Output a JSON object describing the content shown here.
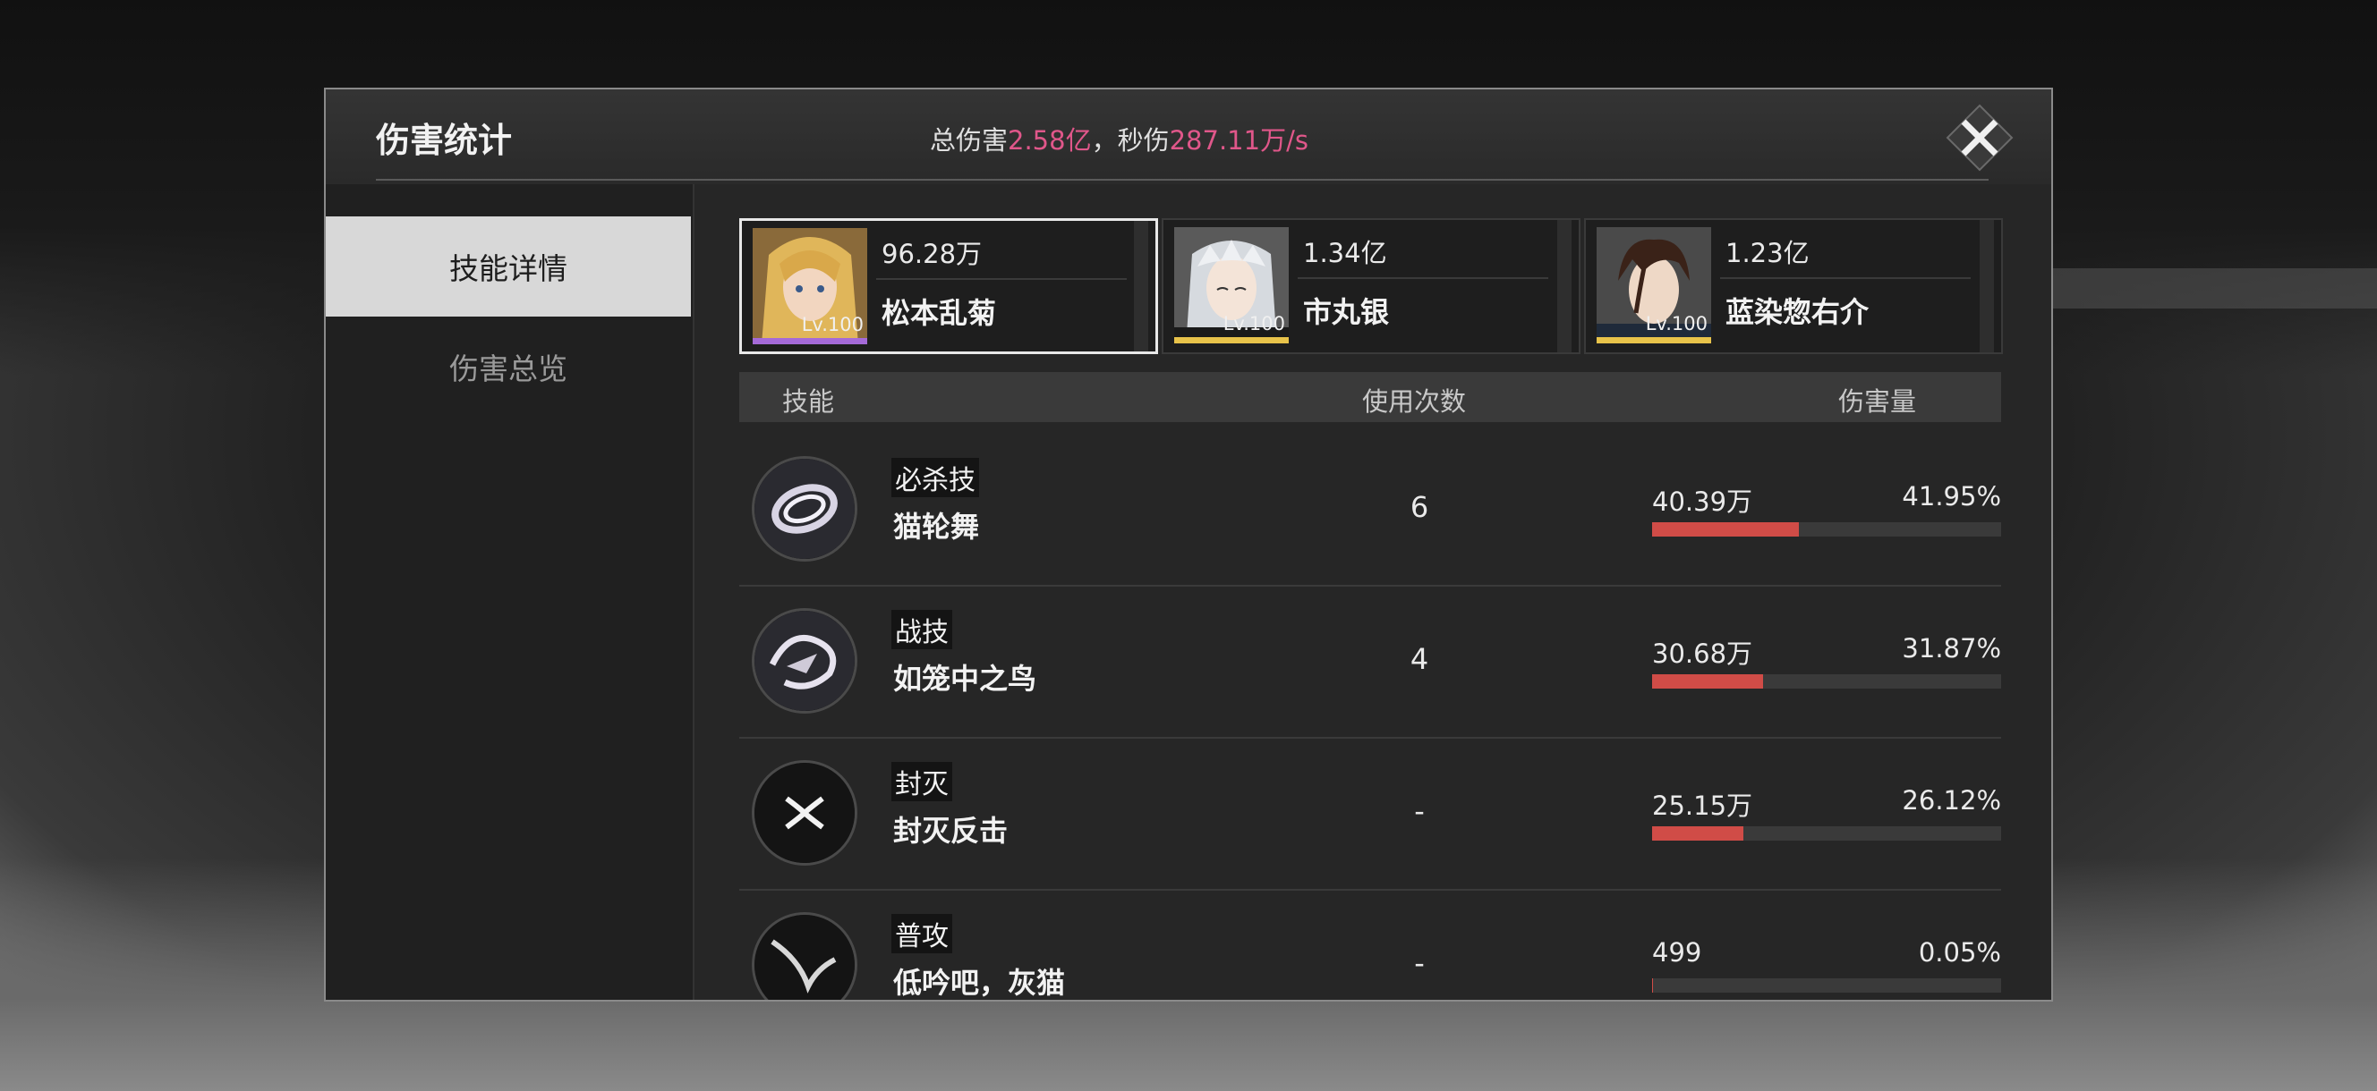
{
  "header": {
    "title": "伤害统计",
    "total_label": "总伤害",
    "total_value": "2.58亿",
    "dps_label": "，秒伤",
    "dps_value": "287.11万/s",
    "highlight_color": "#e0578a"
  },
  "sidebar": {
    "items": [
      {
        "label": "技能详情",
        "active": true
      },
      {
        "label": "伤害总览",
        "active": false
      }
    ]
  },
  "characters": [
    {
      "name": "松本乱菊",
      "damage": "96.28万",
      "level": "Lv.100",
      "selected": true,
      "bar_color": "#a56ad8"
    },
    {
      "name": "市丸银",
      "damage": "1.34亿",
      "level": "Lv.100",
      "selected": false,
      "bar_color": "#e8c34a"
    },
    {
      "name": "蓝染惣右介",
      "damage": "1.23亿",
      "level": "Lv.100",
      "selected": false,
      "bar_color": "#e8c34a"
    }
  ],
  "table": {
    "columns": {
      "skill": "技能",
      "uses": "使用次数",
      "damage": "伤害量"
    },
    "rows": [
      {
        "type": "必杀技",
        "name": "猫轮舞",
        "uses": "6",
        "damage": "40.39万",
        "percent": "41.95%",
        "fraction": 0.4195
      },
      {
        "type": "战技",
        "name": "如笼中之鸟",
        "uses": "4",
        "damage": "30.68万",
        "percent": "31.87%",
        "fraction": 0.3187
      },
      {
        "type": "封灭",
        "name": "封灭反击",
        "uses": "-",
        "damage": "25.15万",
        "percent": "26.12%",
        "fraction": 0.2612
      },
      {
        "type": "普攻",
        "name": "低吟吧，灰猫",
        "uses": "-",
        "damage": "499",
        "percent": "0.05%",
        "fraction": 0.0005
      }
    ]
  }
}
